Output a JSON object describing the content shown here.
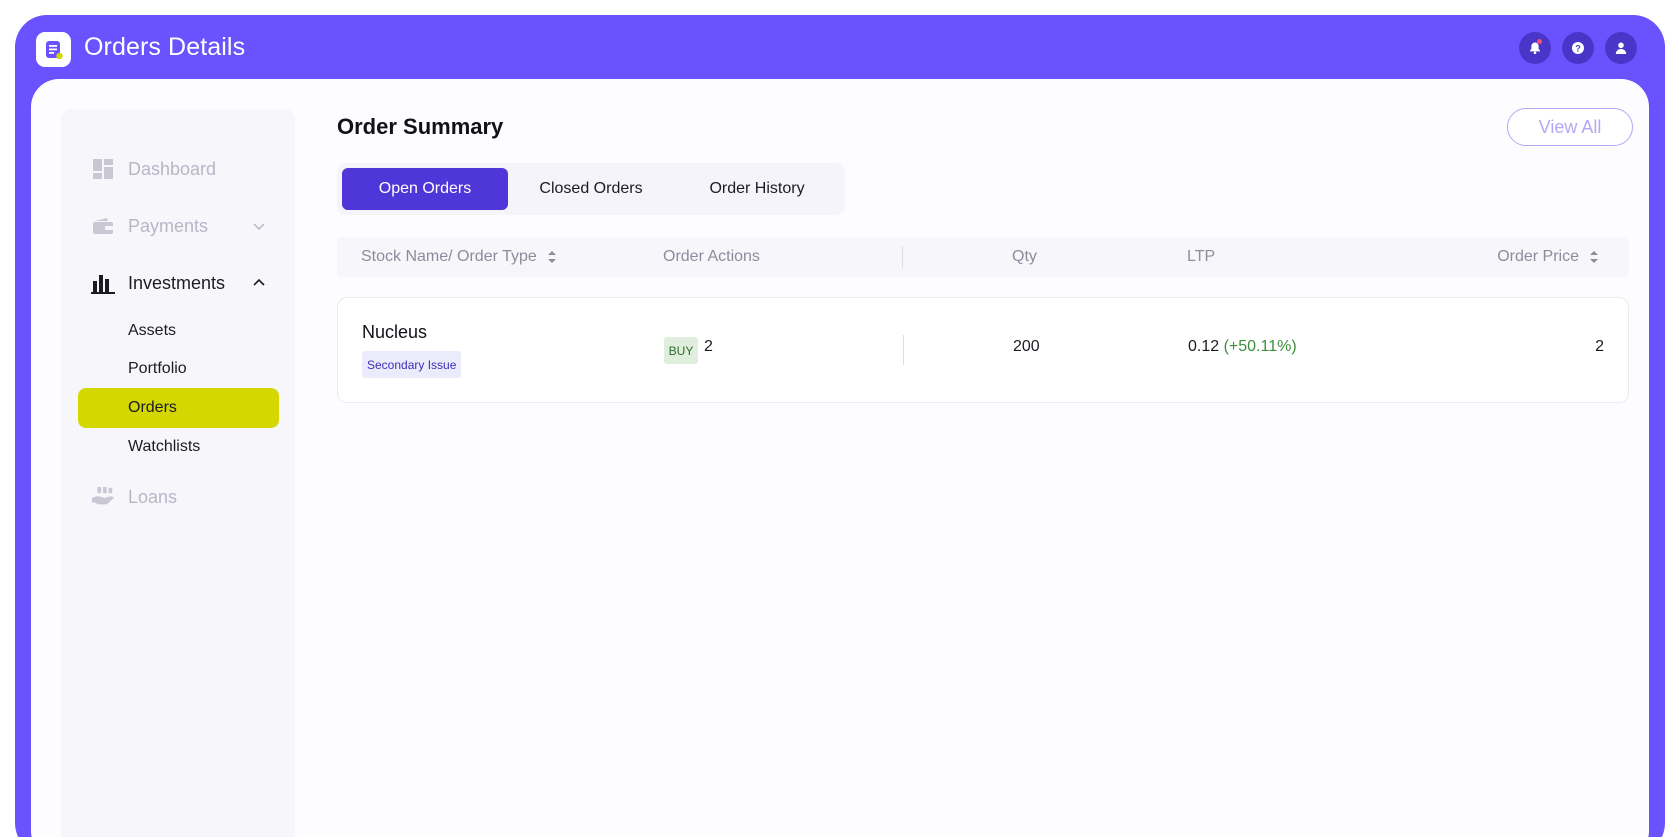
{
  "app": {
    "title": "Orders Details",
    "accent_color": "#6a52fe",
    "header_icons": [
      "notification-bell-icon",
      "help-icon",
      "user-profile-icon"
    ]
  },
  "sidebar": {
    "items": [
      {
        "label": "Dashboard",
        "icon": "dashboard-icon",
        "state": "muted"
      },
      {
        "label": "Payments",
        "icon": "wallet-icon",
        "state": "muted",
        "chevron": "down"
      },
      {
        "label": "Investments",
        "icon": "bar-chart-icon",
        "state": "expanded",
        "chevron": "up"
      },
      {
        "label": "Loans",
        "icon": "hand-money-icon",
        "state": "muted"
      }
    ],
    "investments_sub": [
      {
        "label": "Assets",
        "active": false
      },
      {
        "label": "Portfolio",
        "active": false
      },
      {
        "label": "Orders",
        "active": true
      },
      {
        "label": "Watchlists",
        "active": false
      }
    ],
    "active_color": "#d4d800"
  },
  "main": {
    "section_title": "Order Summary",
    "view_all_label": "View All",
    "tabs": [
      {
        "label": "Open Orders",
        "active": true
      },
      {
        "label": "Closed Orders",
        "active": false
      },
      {
        "label": "Order History",
        "active": false
      }
    ],
    "table": {
      "columns": [
        {
          "label": "Stock Name/ Order Type",
          "sortable": true
        },
        {
          "label": "Order Actions",
          "sortable": false
        },
        {
          "label": "Qty",
          "sortable": false
        },
        {
          "label": "LTP",
          "sortable": false
        },
        {
          "label": "Order Price",
          "sortable": true
        }
      ],
      "rows": [
        {
          "stock_name": "Nucleus",
          "order_type": "Secondary Issue",
          "action": "BUY",
          "action_count": "2",
          "qty": "200",
          "ltp": "0.12",
          "ltp_change": "(+50.11%)",
          "order_price": "2"
        }
      ]
    }
  }
}
